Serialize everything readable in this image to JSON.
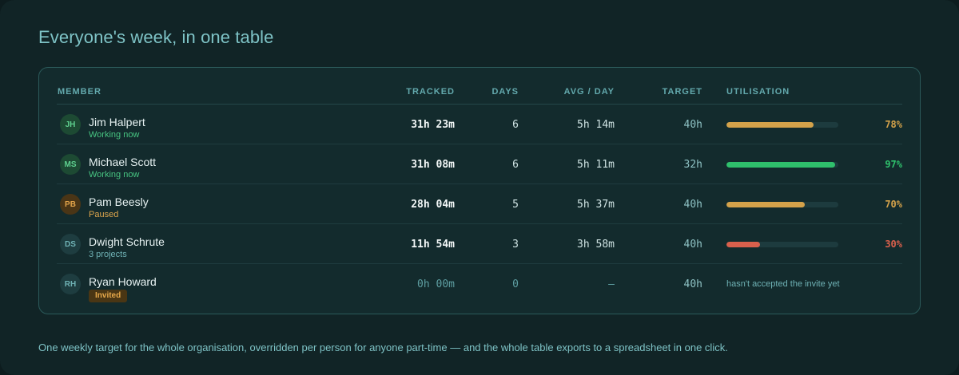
{
  "heading": "Everyone's week, in one table",
  "columns": {
    "member": "MEMBER",
    "tracked": "TRACKED",
    "days": "DAYS",
    "avg": "AVG / DAY",
    "target": "TARGET",
    "utilisation": "UTILISATION"
  },
  "colors": {
    "amber": "#d4a24a",
    "green": "#2fc06c",
    "red": "#d9604c",
    "track": "#1d3b3e"
  },
  "rows": [
    {
      "initials": "JH",
      "name": "Jim Halpert",
      "status": "Working now",
      "status_kind": "working",
      "tracked": "31h 23m",
      "days": "6",
      "avg": "5h 14m",
      "target": "40h",
      "utilisation": 0.78,
      "pct": "78%",
      "level": "amber"
    },
    {
      "initials": "MS",
      "name": "Michael Scott",
      "status": "Working now",
      "status_kind": "working",
      "tracked": "31h 08m",
      "days": "6",
      "avg": "5h 11m",
      "target": "32h",
      "utilisation": 0.97,
      "pct": "97%",
      "level": "green"
    },
    {
      "initials": "PB",
      "name": "Pam Beesly",
      "status": "Paused",
      "status_kind": "paused",
      "tracked": "28h 04m",
      "days": "5",
      "avg": "5h 37m",
      "target": "40h",
      "utilisation": 0.7,
      "pct": "70%",
      "level": "amber"
    },
    {
      "initials": "DS",
      "name": "Dwight Schrute",
      "status": "3 projects",
      "status_kind": "projects",
      "tracked": "11h 54m",
      "days": "3",
      "avg": "3h 58m",
      "target": "40h",
      "utilisation": 0.3,
      "pct": "30%",
      "level": "red"
    },
    {
      "initials": "RH",
      "name": "Ryan Howard",
      "status": "Invited",
      "status_kind": "invited",
      "tracked": "0h 00m",
      "days": "0",
      "avg": "—",
      "target": "40h",
      "note": "hasn't accepted the invite yet"
    }
  ],
  "footer": "One weekly target for the whole organisation, overridden per person for anyone part-time — and the whole table exports to a spreadsheet in one click."
}
